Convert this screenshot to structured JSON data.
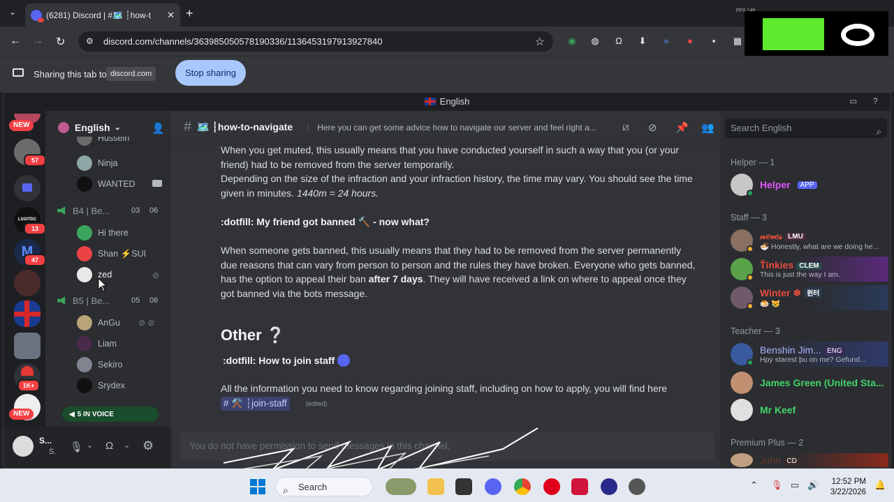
{
  "browser": {
    "tab_title": "(6281) Discord | #🗺️ ┆how-t",
    "url": "discord.com/channels/363985050578190336/1136453197913927840",
    "share_text": "Sharing this tab to",
    "share_site": "discord.com",
    "stop_sharing": "Stop sharing",
    "overlay_text": "FPS 146"
  },
  "discord": {
    "window_title": "English",
    "server_name": "English",
    "rail": {
      "new_pill_top": "NEW",
      "badge_1": "57",
      "badge_2": "13",
      "badge_3": "47",
      "badge_4": "1K+",
      "new_pill_bottom": "NEW"
    },
    "sidebar": {
      "top_cut_member": "Hussein",
      "members_a": [
        "Ninja",
        "WANTED"
      ],
      "vc_b4": {
        "name": "B4 | Be...",
        "count_a": "03",
        "count_b": "06"
      },
      "members_b4": [
        "Hi there",
        "Shan ⚡SUI",
        "zed"
      ],
      "vc_b5": {
        "name": "B5 | Be...",
        "count_a": "05",
        "count_b": "06"
      },
      "members_b5": [
        "AnGu",
        "Liam",
        "Sekiro",
        "Srydex"
      ],
      "voice_pill": "5 IN VOICE",
      "user_name": "S...",
      "user_status": "S."
    },
    "channel": {
      "name": "🗺️ ┆how-to-navigate",
      "topic": "Here you can get some advice how to navigate our server and feel right a..."
    },
    "search_placeholder": "Search English",
    "messages": {
      "muted_p1": "When you get muted, this usually means that you have conducted yourself in such a way that you (or your friend) had to be removed from the server temporarily.",
      "muted_p2_a": "Depending on the size of the infraction and your infraction history, the time may vary. You should see the time given in minutes.",
      "muted_p2_b": "1440m = 24 hours.",
      "banned_head": ":dotfill:  My friend got banned 🔨 - now what?",
      "banned_p_a": "When someone gets banned, this usually means that they had to be removed from the server permanently due reasons that can vary from person to person and the rules they have broken. Everyone who gets banned, has the option to appeal their ban",
      "banned_p_b": "after 7 days",
      "banned_p_c": ". They will have received a link on where to appeal once they got banned via the bots message.",
      "other_heading": "Other ❔",
      "staff_head": ":dotfill:  How to join staff",
      "staff_p": "All the information you need to know regarding joining staff, including on how to apply, you will find here",
      "staff_link": "# ⚒️ ┆join-staff",
      "edited": "(edited)",
      "composer": "You do not have permission to send messages in this channel."
    },
    "members": {
      "helper_group": "Helper — 1",
      "helper_name": "Helper",
      "helper_tag": "APP",
      "staff_group": "Staff — 3",
      "staff": [
        {
          "name": "𝓃𝑒𝓋𝑒𝓈",
          "tag": "LMU",
          "status": "🍜 Honestly, what are we doing he..."
        },
        {
          "name": "Ťinkies",
          "tag": "CLEM",
          "status": "This is just the way I am."
        },
        {
          "name": "Winter ❄",
          "tag": "윈터",
          "status": "🍮 😿"
        }
      ],
      "teacher_group": "Teacher — 3",
      "teachers": [
        {
          "name": "Benshin Jim...",
          "tag": "ENG",
          "status": "Hpy starest þu on me? Gefund..."
        },
        {
          "name": "James Green (United Sta...",
          "tag": "",
          "status": ""
        },
        {
          "name": "Mr Keef",
          "tag": "",
          "status": ""
        }
      ],
      "premium_group": "Premium Plus — 2",
      "premium_first": "John",
      "premium_tag": "CD"
    }
  },
  "taskbar": {
    "search": "Search",
    "time": "12:52 PM",
    "date": "3/22/2026"
  },
  "colors": {
    "blurple": "#5865f2",
    "green": "#23a55a",
    "red_badge": "#f23f43",
    "helper_pink": "#e056fd",
    "staff_red": "#e74c3c",
    "teacher_green": "#43d36a"
  }
}
